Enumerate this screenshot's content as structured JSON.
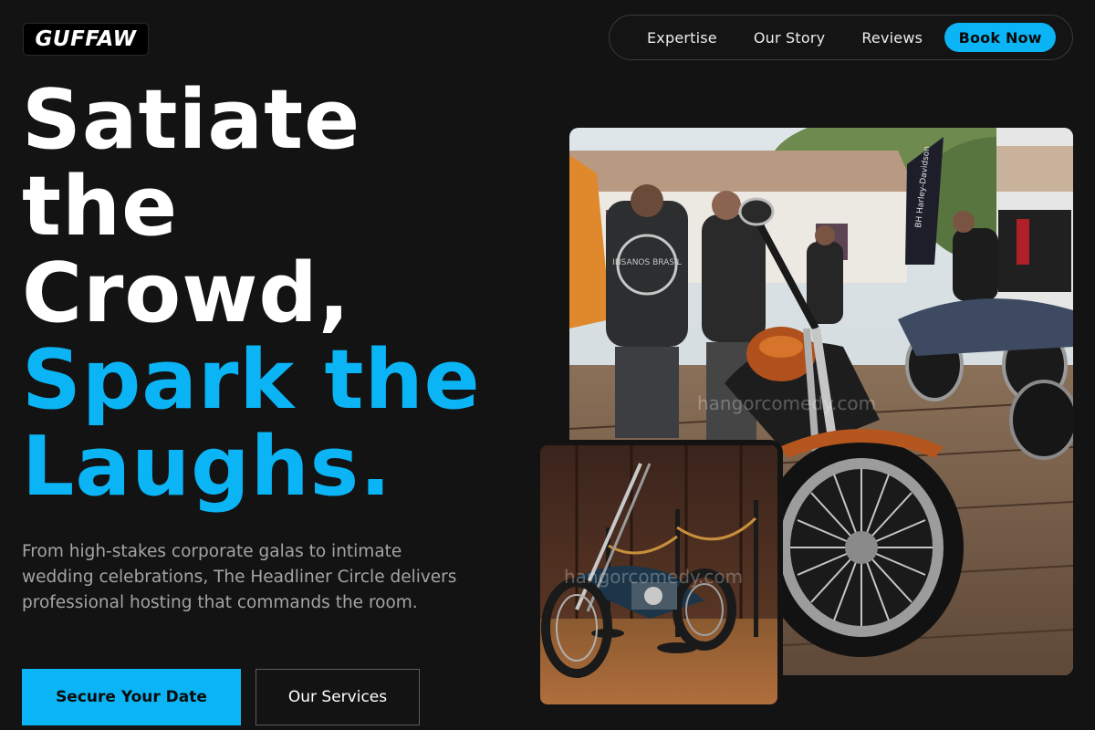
{
  "logo": {
    "text": "GUFFAW"
  },
  "nav": {
    "items": [
      {
        "label": "Expertise"
      },
      {
        "label": "Our Story"
      },
      {
        "label": "Reviews"
      }
    ],
    "cta_label": "Book Now"
  },
  "hero": {
    "headline_white": [
      "Satiate",
      "the",
      "Crowd,"
    ],
    "headline_blue": [
      "Spark the",
      "Laughs."
    ],
    "description": "From high-stakes corporate galas to intimate wedding celebrations, The Headliner Circle delivers professional hosting that commands the room.",
    "primary_button": "Secure Your Date",
    "secondary_button": "Our Services"
  },
  "images": {
    "main_watermark": "hangorcomedy.com",
    "small_watermark": "hangorcomedy.com",
    "main_banner_text": "BH Harley-Davidson",
    "main_vest_text": "INSANOS BRASIL"
  },
  "colors": {
    "accent": "#0ab4f5",
    "background": "#131313",
    "text_muted": "#a4a4a4"
  }
}
